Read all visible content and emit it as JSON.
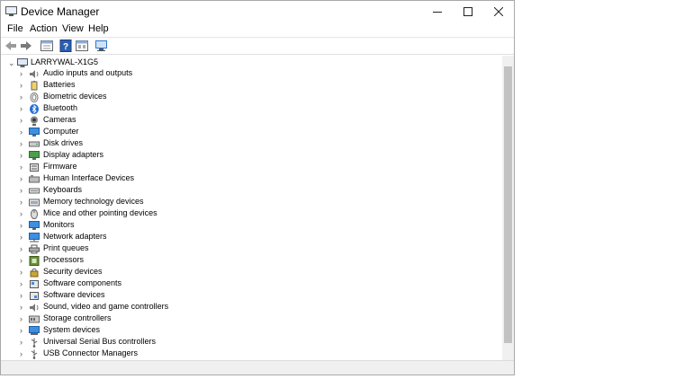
{
  "window": {
    "title": "Device Manager"
  },
  "menu": [
    "File",
    "Action",
    "View",
    "Help"
  ],
  "tree": {
    "root": "LARRYWAL-X1G5",
    "items": [
      "Audio inputs and outputs",
      "Batteries",
      "Biometric devices",
      "Bluetooth",
      "Cameras",
      "Computer",
      "Disk drives",
      "Display adapters",
      "Firmware",
      "Human Interface Devices",
      "Keyboards",
      "Memory technology devices",
      "Mice and other pointing devices",
      "Monitors",
      "Network adapters",
      "Print queues",
      "Processors",
      "Security devices",
      "Software components",
      "Software devices",
      "Sound, video and game controllers",
      "Storage controllers",
      "System devices",
      "Universal Serial Bus controllers",
      "USB Connector Managers"
    ]
  },
  "colors": {
    "accent": "#2b78d0",
    "bluetooth": "#1e6fd9",
    "border": "#a9a9a9"
  }
}
